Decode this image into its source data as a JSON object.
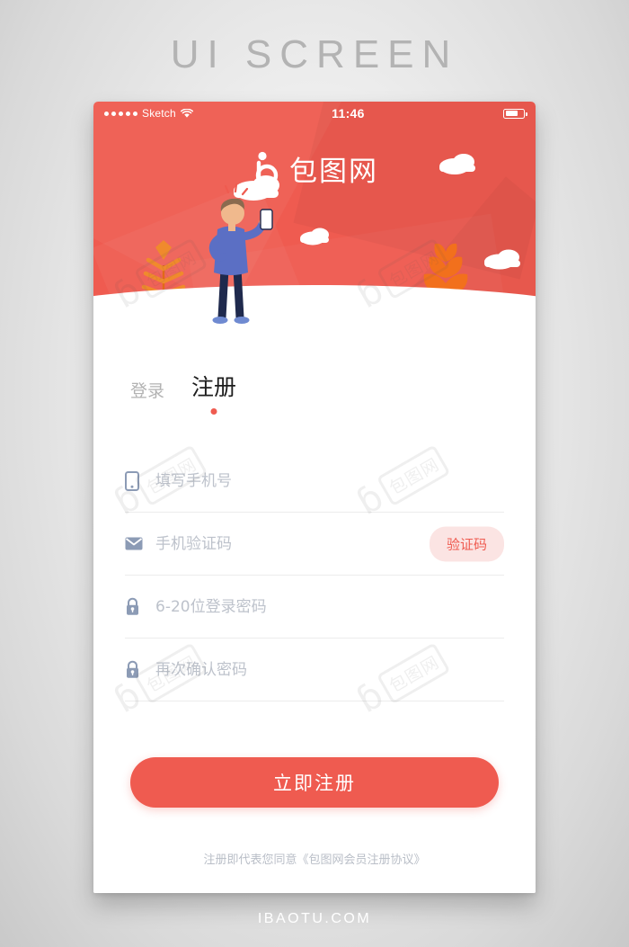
{
  "page": {
    "title": "UI SCREEN",
    "footer": "IBAOTU.COM"
  },
  "statusbar": {
    "carrier": "Sketch",
    "time": "11:46",
    "signal_dots": 5,
    "wifi_icon": "wifi-icon",
    "battery_icon": "battery-icon",
    "battery_level": 72
  },
  "brand": {
    "logo_icon": "baotu-logo-icon",
    "name": "包图网"
  },
  "illustration": {
    "scene": "person-holding-phone-autumn",
    "clouds": 3,
    "trees": 1,
    "leaves": 1,
    "colors": {
      "sky": "#ef5b50",
      "ground": "#ffffff",
      "sweater": "#5b6fc4",
      "pants": "#1f2a4d",
      "shoes": "#6f8ad1",
      "hair": "#8a6a4f",
      "skin": "#f0b98d",
      "tree": "#f08a2c",
      "leaf": "#f2701c",
      "phone": "#ffffff"
    }
  },
  "tabs": [
    {
      "label": "登录",
      "active": false
    },
    {
      "label": "注册",
      "active": true
    }
  ],
  "fields": [
    {
      "name": "phone",
      "icon": "mobile-phone-icon",
      "placeholder": "填写手机号",
      "value": "",
      "type": "tel"
    },
    {
      "name": "verification-code",
      "icon": "envelope-icon",
      "placeholder": "手机验证码",
      "value": "",
      "type": "text",
      "action_label": "验证码"
    },
    {
      "name": "password",
      "icon": "lock-icon",
      "placeholder": "6-20位登录密码",
      "value": "",
      "type": "password"
    },
    {
      "name": "confirm-password",
      "icon": "lock-icon",
      "placeholder": "再次确认密码",
      "value": "",
      "type": "password"
    }
  ],
  "submit": {
    "label": "立即注册"
  },
  "agreement": {
    "prefix": "注册即代表您同意",
    "link": "《包图网会员注册协议》"
  },
  "watermark": {
    "mark": "ɓ",
    "text": "包图网"
  },
  "colors": {
    "brand_red": "#ef5b50",
    "code_btn_bg": "#fbe4e3",
    "icon_blue_gray": "#8c9bb5",
    "placeholder": "#bdc2cb",
    "divider": "#ececec",
    "tab_active": "#1d1d1d",
    "tab_inactive": "#b2b2b2",
    "page_bg": "#e9e9e9",
    "title_gray": "#b3b3b3"
  }
}
